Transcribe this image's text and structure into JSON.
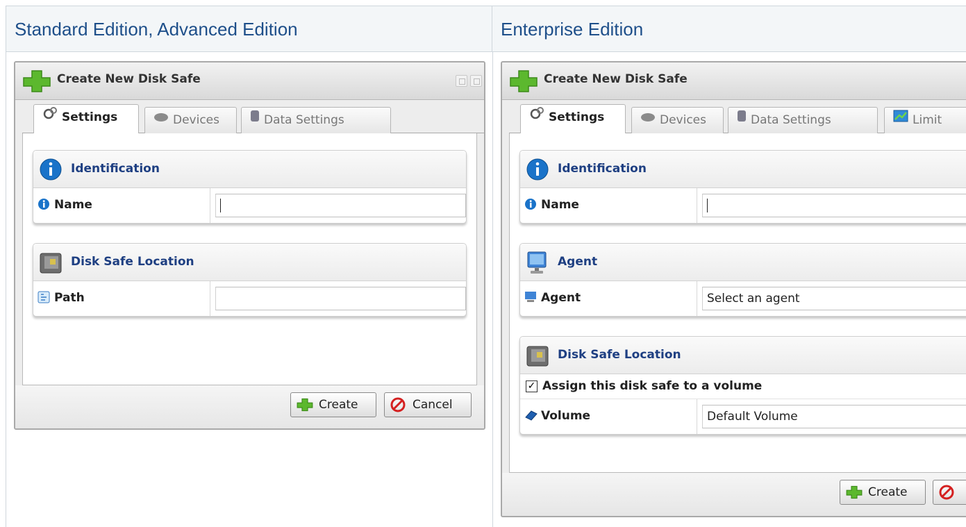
{
  "columns": {
    "left_heading": "Standard Edition, Advanced Edition",
    "right_heading": "Enterprise Edition"
  },
  "left_dialog": {
    "title": "Create New Disk Safe",
    "tabs": [
      {
        "label": "Settings",
        "active": true
      },
      {
        "label": "Devices",
        "active": false
      },
      {
        "label": "Data Settings",
        "active": false
      }
    ],
    "identification": {
      "heading": "Identification",
      "name_label": "Name",
      "name_value": ""
    },
    "location": {
      "heading": "Disk Safe Location",
      "path_label": "Path",
      "path_value": ""
    },
    "buttons": {
      "create": "Create",
      "cancel": "Cancel"
    }
  },
  "right_dialog": {
    "title": "Create New Disk Safe",
    "tabs": [
      {
        "label": "Settings",
        "active": true
      },
      {
        "label": "Devices",
        "active": false
      },
      {
        "label": "Data Settings",
        "active": false
      },
      {
        "label": "Limit",
        "active": false
      }
    ],
    "identification": {
      "heading": "Identification",
      "name_label": "Name",
      "name_value": ""
    },
    "agent": {
      "heading": "Agent",
      "agent_label": "Agent",
      "agent_value": "Select an agent"
    },
    "location": {
      "heading": "Disk Safe Location",
      "assign_label": "Assign this disk safe to a volume",
      "assign_checked": true,
      "volume_label": "Volume",
      "volume_value": "Default Volume"
    },
    "buttons": {
      "create": "Create"
    }
  },
  "colors": {
    "heading_text": "#1e4f8a",
    "section_title": "#1e3f82",
    "plus_green": "#4caf2a",
    "cancel_red": "#d42020"
  }
}
